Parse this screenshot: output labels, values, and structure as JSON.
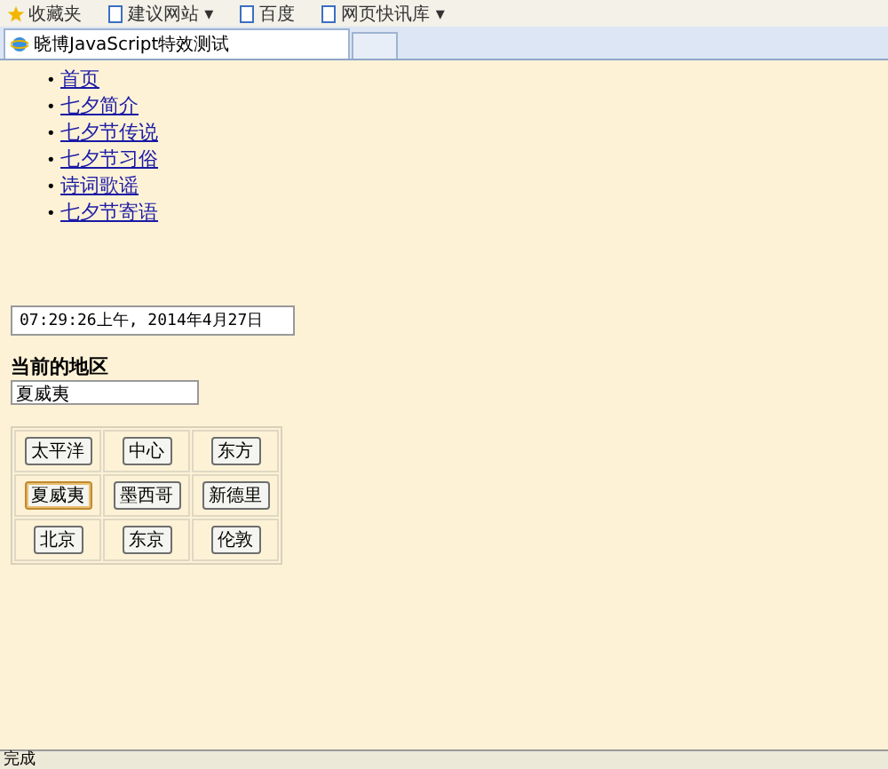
{
  "toolbar": {
    "items": [
      {
        "label": "收藏夹",
        "kind": "star"
      },
      {
        "label": "建议网站 ▾",
        "kind": "page"
      },
      {
        "label": "百度",
        "kind": "page"
      },
      {
        "label": "网页快讯库 ▾",
        "kind": "page"
      }
    ]
  },
  "tabs": [
    {
      "label": "晓博JavaScript特效测试",
      "selected": true
    }
  ],
  "nav_links": [
    {
      "marker": "•",
      "label": "首页"
    },
    {
      "marker": "•",
      "label": "七夕简介"
    },
    {
      "marker": "•",
      "label": "七夕节传说"
    },
    {
      "marker": "•",
      "label": "七夕节习俗"
    },
    {
      "marker": "•",
      "label": "诗词歌谣"
    },
    {
      "marker": "•",
      "label": "七夕节寄语"
    }
  ],
  "clock": {
    "value": "07:29:26上午, 2014年4月27日"
  },
  "region": {
    "heading": "当前的地区",
    "value": "夏威夷"
  },
  "region_buttons": [
    [
      {
        "label": "太平洋",
        "selected": false
      },
      {
        "label": "中心",
        "selected": false
      },
      {
        "label": "东方",
        "selected": false
      }
    ],
    [
      {
        "label": "夏威夷",
        "selected": true
      },
      {
        "label": "墨西哥",
        "selected": false
      },
      {
        "label": "新德里",
        "selected": false
      }
    ],
    [
      {
        "label": "北京",
        "selected": false
      },
      {
        "label": "东京",
        "selected": false
      },
      {
        "label": "伦敦",
        "selected": false
      }
    ]
  ],
  "status_bar": {
    "text": "完成"
  }
}
